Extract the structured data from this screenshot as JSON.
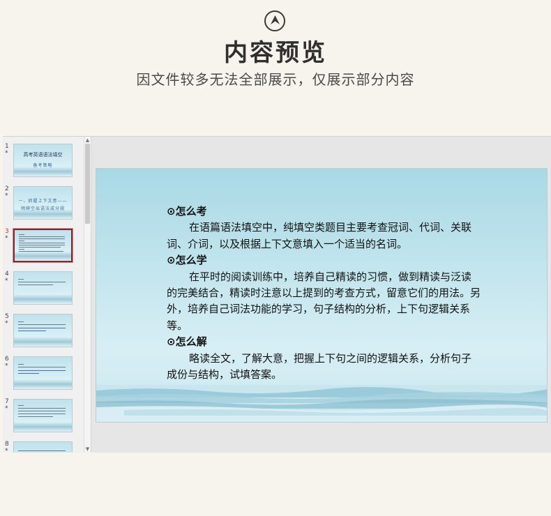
{
  "header": {
    "logo_icon": "chevron-up-circle-icon",
    "title": "内容预览",
    "subtitle": "因文件较多无法全部展示，仅展示部分内容"
  },
  "thumbnails": [
    {
      "number": "1",
      "star": "*",
      "title": "高考英语语法填空",
      "subtitle": "备考策略"
    },
    {
      "number": "2",
      "star": "*",
      "title": "一、抓握上下文意——",
      "subtitle": "明辨空出语法成分规"
    },
    {
      "number": "3",
      "star": "*",
      "selected": true
    },
    {
      "number": "4",
      "star": "*"
    },
    {
      "number": "5",
      "star": "*"
    },
    {
      "number": "6",
      "star": "*"
    },
    {
      "number": "7",
      "star": "*"
    },
    {
      "number": "8",
      "star": "*"
    }
  ],
  "slide": {
    "sections": [
      {
        "heading": "⊙怎么考",
        "text": "在语篇语法填空中，纯填空类题目主要考查冠词、代词、关联词、介词，以及根据上下文意填入一个适当的名词。"
      },
      {
        "heading": "⊙怎么学",
        "text": "在平时的阅读训练中，培养自己精读的习惯，做到精读与泛读的完美结合，精读时注意以上提到的考查方式，留意它们的用法。另外，培养自己词法功能的学习，句子结构的分析，上下句逻辑关系等。"
      },
      {
        "heading": "⊙怎么解",
        "text": "略读全文，了解大意，把握上下句之间的逻辑关系，分析句子成份与结构，试填答案。"
      }
    ]
  },
  "colors": {
    "page_background": "#f7f4ee",
    "selected_border": "#8a2530",
    "slide_background": "#c3e5ee"
  }
}
